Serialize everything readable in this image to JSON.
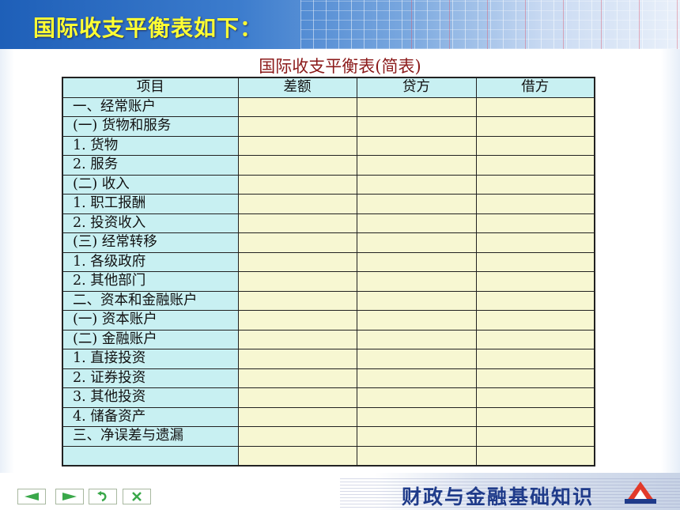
{
  "header": {
    "title": "国际收支平衡表如下："
  },
  "table": {
    "title": "国际收支平衡表(简表)",
    "columns": [
      "项目",
      "差额",
      "贷方",
      "借方"
    ],
    "rows": [
      "一、经常账户",
      "(一) 货物和服务",
      "1.  货物",
      "2.  服务",
      "(二) 收入",
      "1.  职工报酬",
      "2.  投资收入",
      "(三) 经常转移",
      "1.  各级政府",
      "2.  其他部门",
      "二、资本和金融账户",
      "(一) 资本账户",
      "(二) 金融账户",
      "1.  直接投资",
      "2.  证券投资",
      "3.  其他投资",
      "4.  储备资产",
      "三、净误差与遗漏",
      ""
    ]
  },
  "footer": {
    "brand": "财政与金融基础知识",
    "nav_icons": [
      "prev-arrow-icon",
      "next-arrow-icon",
      "return-icon",
      "close-icon"
    ],
    "colors": {
      "accent": "#1f3b8a",
      "nav_green": "#3aa84a",
      "logo_red": "#e23a2a"
    }
  }
}
